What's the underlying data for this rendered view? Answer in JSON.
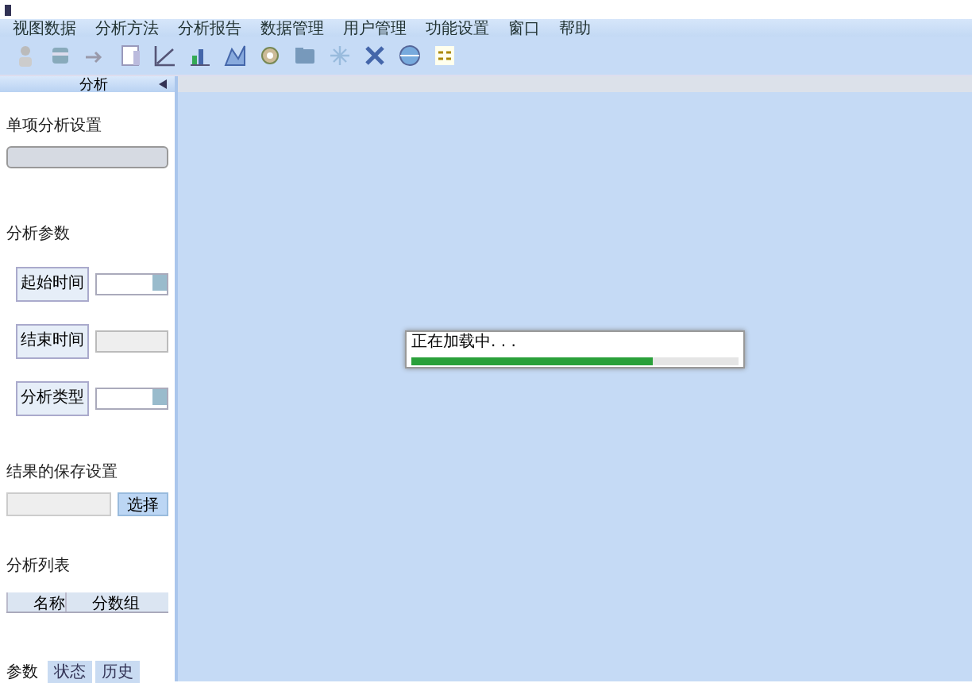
{
  "menu": [
    "视图数据",
    "分析方法",
    "分析报告",
    "数据管理",
    "用户管理",
    "功能设置",
    "窗口",
    "帮助"
  ],
  "panel": {
    "title": "分析",
    "single_setting": {
      "title": "单项分析设置"
    },
    "params": {
      "title": "分析参数",
      "rows": [
        {
          "kind": "select",
          "label": "起始时间"
        },
        {
          "kind": "text",
          "label": "结束时间"
        },
        {
          "kind": "select",
          "label": "分析类型"
        }
      ]
    },
    "save": {
      "title": "结果的保存设置",
      "button": "选择"
    },
    "list": {
      "title": "分析列表",
      "columns": [
        "名称",
        "分数组"
      ]
    },
    "tabs": [
      {
        "label": "参数",
        "selected": true
      },
      {
        "label": "状态",
        "selected": false
      },
      {
        "label": "历史",
        "selected": false
      }
    ]
  },
  "progress": {
    "message": "正在加载中. . .",
    "level": 0.74
  }
}
